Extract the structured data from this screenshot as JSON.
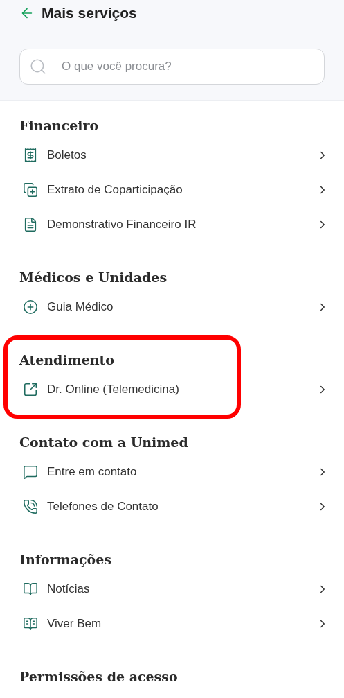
{
  "header": {
    "title": "Mais serviços"
  },
  "search": {
    "placeholder": "O que você procura?"
  },
  "sections": [
    {
      "title": "Financeiro",
      "highlighted": false,
      "items": [
        {
          "label": "Boletos"
        },
        {
          "label": "Extrato de Coparticipação"
        },
        {
          "label": "Demonstrativo Financeiro IR"
        }
      ]
    },
    {
      "title": "Médicos e Unidades",
      "highlighted": false,
      "items": [
        {
          "label": "Guia Médico"
        }
      ]
    },
    {
      "title": "Atendimento",
      "highlighted": true,
      "items": [
        {
          "label": "Dr. Online (Telemedicina)"
        }
      ]
    },
    {
      "title": "Contato com a Unimed",
      "highlighted": false,
      "items": [
        {
          "label": "Entre em contato"
        },
        {
          "label": "Telefones de Contato"
        }
      ]
    },
    {
      "title": "Informações",
      "highlighted": false,
      "items": [
        {
          "label": "Notícias"
        },
        {
          "label": "Viver Bem"
        }
      ]
    },
    {
      "title": "Permissões de acesso",
      "highlighted": false
    }
  ]
}
